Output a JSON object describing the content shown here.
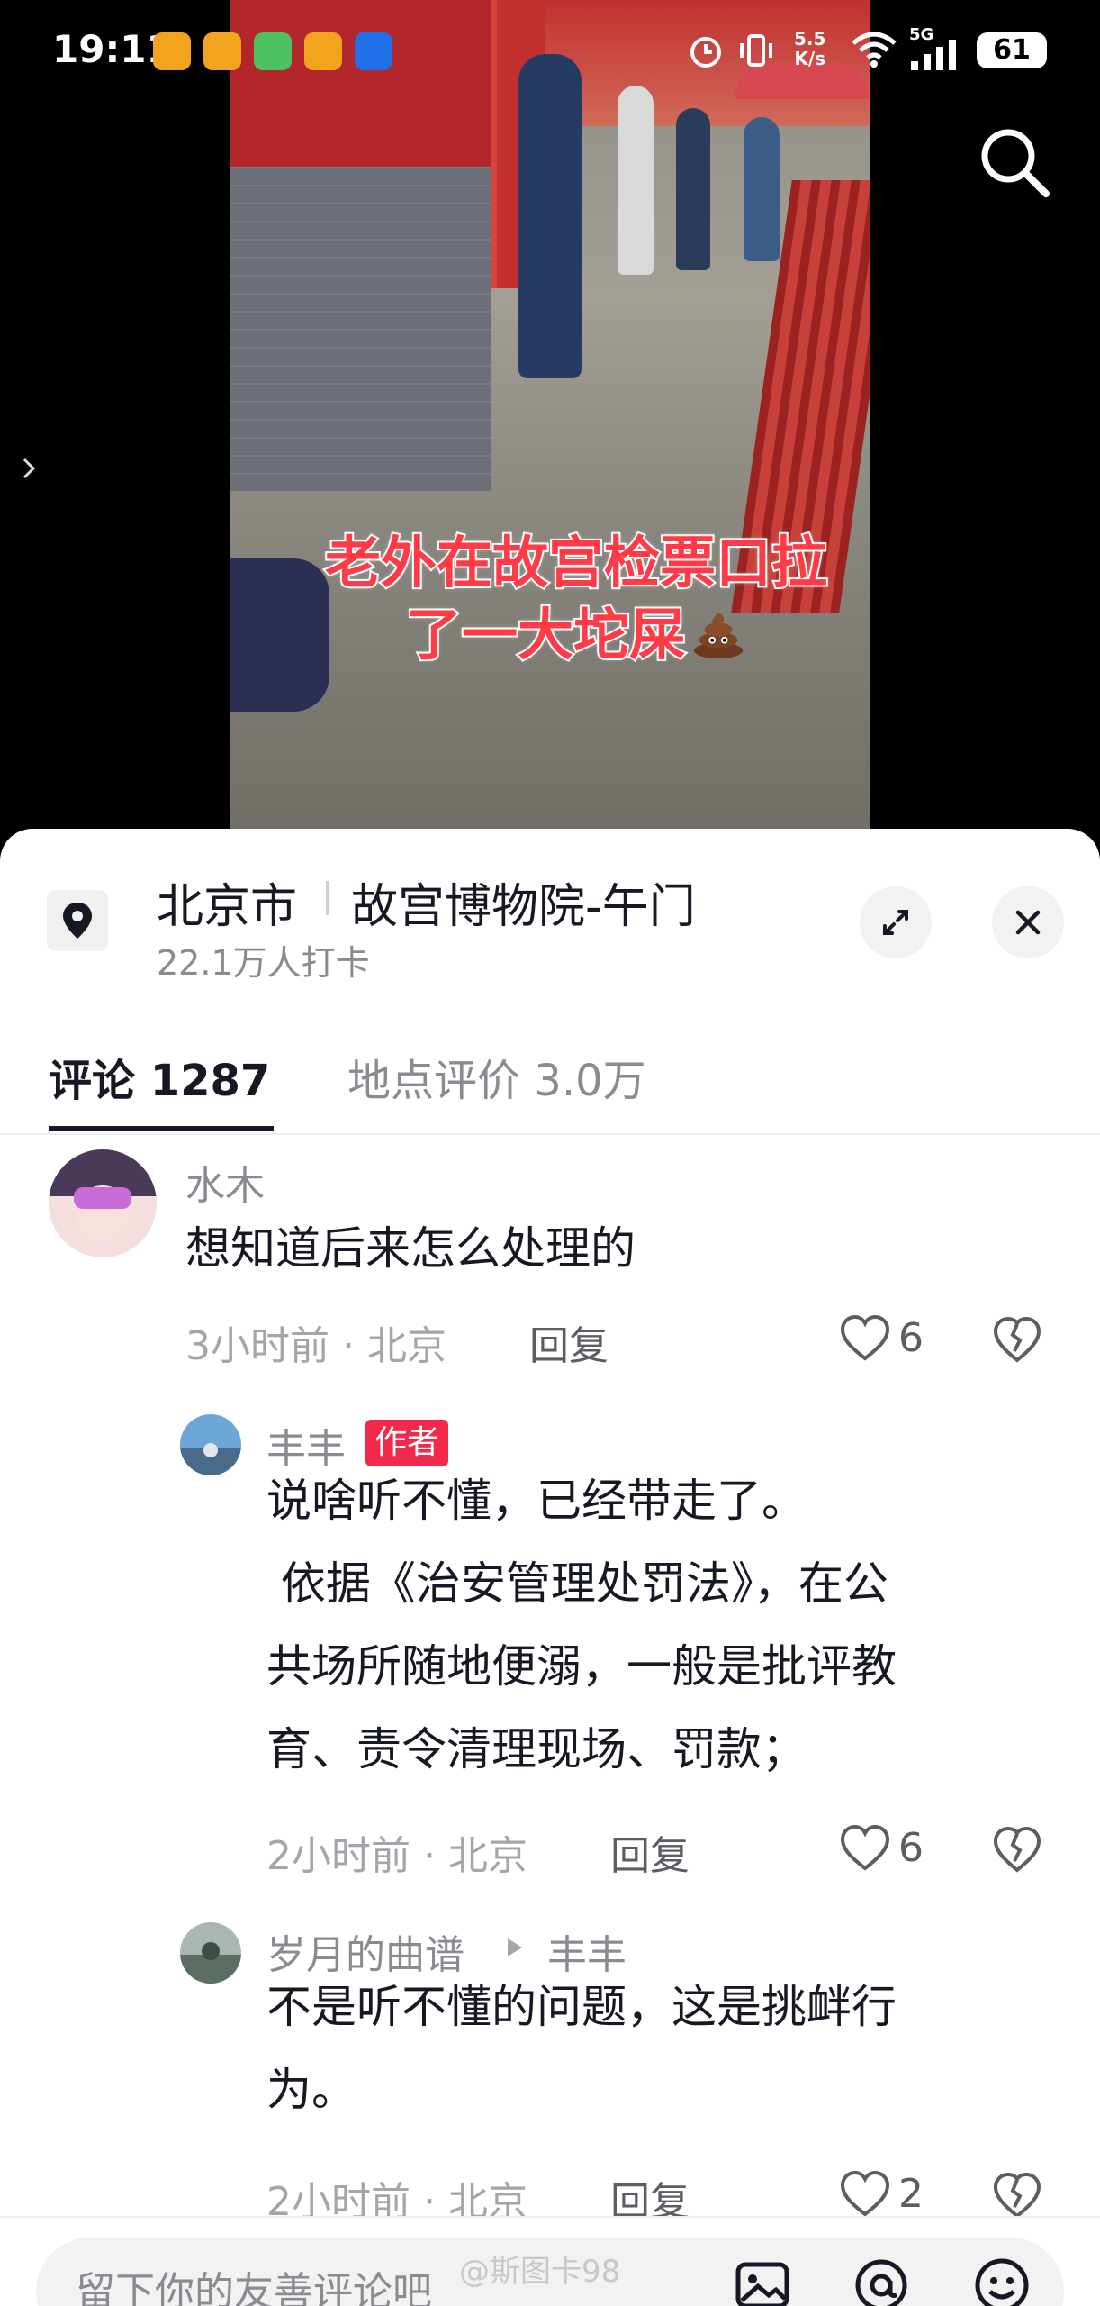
{
  "status_bar": {
    "time": "19:11",
    "speed_value": "5.5",
    "speed_unit": "K/s",
    "network": "5G",
    "battery": "61"
  },
  "video": {
    "caption_line1": "老外在故宫检票口拉",
    "caption_line2": "了一大坨屎"
  },
  "location": {
    "city": "北京市",
    "place": "故宫博物院-午门",
    "checkins": "22.1万人打卡"
  },
  "tabs": {
    "comments_label": "评论",
    "comments_count": "1287",
    "reviews_label": "地点评价",
    "reviews_count": "3.0万"
  },
  "comments": [
    {
      "username": "水木",
      "text": "想知道后来怎么处理的",
      "time": "3小时前",
      "location": "北京",
      "reply_label": "回复",
      "likes": "6"
    },
    {
      "username": "丰丰",
      "badge": "作者",
      "text_lines": [
        "说啥听不懂，已经带走了。",
        " 依据《治安管理处罚法》，在公",
        "共场所随地便溺，一般是批评教",
        "育、责令清理现场、罚款；"
      ],
      "time": "2小时前",
      "location": "北京",
      "reply_label": "回复",
      "likes": "6"
    },
    {
      "username": "岁月的曲谱",
      "reply_to": "丰丰",
      "text_lines": [
        "不是听不懂的问题，这是挑衅行",
        "为。"
      ],
      "time": "2小时前",
      "location": "北京",
      "reply_label": "回复",
      "likes": "2"
    }
  ],
  "input": {
    "placeholder": "留下你的友善评论吧"
  },
  "watermark": "@斯图卡98",
  "colors": {
    "caption_red": "#ff3b47",
    "author_badge": "#f2294a",
    "text_primary": "#161823",
    "text_secondary": "#8a8b91"
  }
}
